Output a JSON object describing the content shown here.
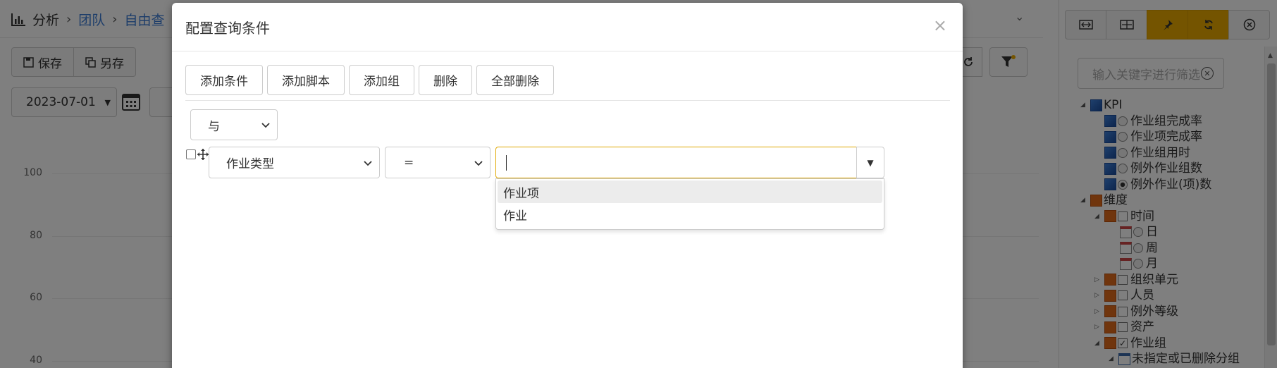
{
  "header": {
    "app_title": "分析",
    "breadcrumb": [
      "团队",
      "自由查"
    ]
  },
  "toolbar": {
    "save_label": "保存",
    "save_as_label": "另存"
  },
  "filters": {
    "date_value": "2023-07-01"
  },
  "chart_data": {
    "type": "line",
    "yticks": [
      "100",
      "80",
      "60",
      "40"
    ]
  },
  "right_panel": {
    "search_placeholder": "输入关键字进行筛选",
    "tree": {
      "kpi": {
        "label": "KPI",
        "items": [
          "作业组完成率",
          "作业项完成率",
          "作业组用时",
          "例外作业组数",
          "例外作业(项)数"
        ]
      },
      "dimension": {
        "label": "维度",
        "time": {
          "label": "时间",
          "items": [
            "日",
            "周",
            "月"
          ]
        },
        "others": [
          "组织单元",
          "人员",
          "例外等级",
          "资产"
        ],
        "job_group": {
          "label": "作业组",
          "child": "未指定或已删除分组"
        }
      }
    }
  },
  "modal": {
    "title": "配置查询条件",
    "close_symbol": "×",
    "buttons": {
      "add_condition": "添加条件",
      "add_script": "添加脚本",
      "add_group": "添加组",
      "delete": "删除",
      "delete_all": "全部删除"
    },
    "logic_operator": "与",
    "condition": {
      "field": "作业类型",
      "operator": "=",
      "value": ""
    },
    "dropdown_options": [
      "作业项",
      "作业"
    ]
  },
  "colors": {
    "accent": "#e8a800",
    "link": "#3a7bd5"
  }
}
